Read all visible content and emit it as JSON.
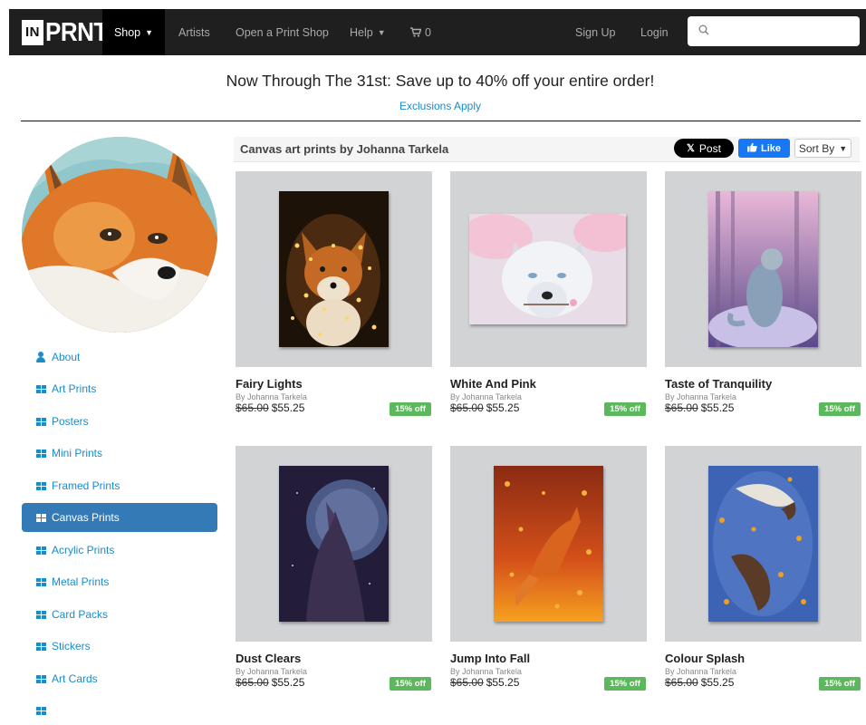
{
  "navbar": {
    "logo_in": "IN",
    "logo_rest": "PRNT",
    "shop_label": "Shop",
    "artists_label": "Artists",
    "open_shop_label": "Open a Print Shop",
    "help_label": "Help",
    "cart_count": "0",
    "signup_label": "Sign Up",
    "login_label": "Login",
    "search_placeholder": ""
  },
  "promo": {
    "title": "Now Through The 31st: Save up to 40% off your entire order!",
    "link": "Exclusions Apply"
  },
  "sidebar": {
    "items": [
      {
        "label": "About",
        "icon": "user-icon"
      },
      {
        "label": "Art Prints",
        "icon": "grid-icon"
      },
      {
        "label": "Posters",
        "icon": "grid-icon"
      },
      {
        "label": "Mini Prints",
        "icon": "grid-icon"
      },
      {
        "label": "Framed Prints",
        "icon": "grid-icon"
      },
      {
        "label": "Canvas Prints",
        "icon": "grid-icon",
        "active": true
      },
      {
        "label": "Acrylic Prints",
        "icon": "grid-icon"
      },
      {
        "label": "Metal Prints",
        "icon": "grid-icon"
      },
      {
        "label": "Card Packs",
        "icon": "grid-icon"
      },
      {
        "label": "Stickers",
        "icon": "grid-icon"
      },
      {
        "label": "Art Cards",
        "icon": "grid-icon"
      }
    ]
  },
  "content": {
    "title": "Canvas art prints by Johanna Tarkela",
    "x_post_label": "Post",
    "like_label": "Like",
    "sort_label": "Sort By"
  },
  "products": [
    {
      "title": "Fairy Lights",
      "artist": "By Johanna Tarkela",
      "old_price": "$65.00",
      "price": "$55.25",
      "badge": "15% off"
    },
    {
      "title": "White And Pink",
      "artist": "By Johanna Tarkela",
      "old_price": "$65.00",
      "price": "$55.25",
      "badge": "15% off"
    },
    {
      "title": "Taste of Tranquility",
      "artist": "By Johanna Tarkela",
      "old_price": "$65.00",
      "price": "$55.25",
      "badge": "15% off"
    },
    {
      "title": "Dust Clears",
      "artist": "By Johanna Tarkela",
      "old_price": "$65.00",
      "price": "$55.25",
      "badge": "15% off"
    },
    {
      "title": "Jump Into Fall",
      "artist": "By Johanna Tarkela",
      "old_price": "$65.00",
      "price": "$55.25",
      "badge": "15% off"
    },
    {
      "title": "Colour Splash",
      "artist": "By Johanna Tarkela",
      "old_price": "$65.00",
      "price": "$55.25",
      "badge": "15% off"
    }
  ],
  "colors": {
    "navbar_bg": "#1f1f1f",
    "link_blue": "#1a8cc9",
    "active_blue": "#337ab7",
    "badge_green": "#5cb85c",
    "facebook_blue": "#1877f2"
  }
}
